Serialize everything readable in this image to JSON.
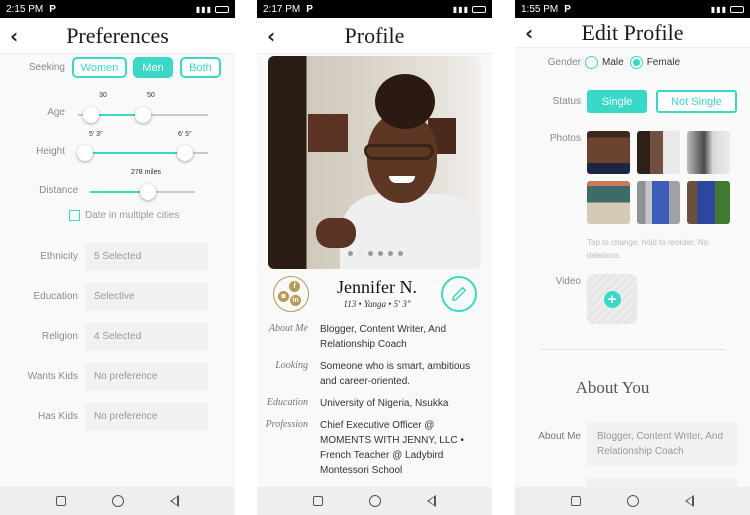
{
  "screens": {
    "preferences": {
      "status_time": "2:15 PM",
      "status_app": "P",
      "title": "Preferences",
      "seeking": {
        "label": "Seeking",
        "options": [
          "Women",
          "Men",
          "Both"
        ],
        "selected": "Men"
      },
      "age": {
        "label": "Age",
        "min_value": "30",
        "max_value": "50",
        "range_start": 0.1,
        "range_end": 0.5
      },
      "height": {
        "label": "Height",
        "min_value": "5' 3\"",
        "max_value": "6' 5\"",
        "range_start": 0.05,
        "range_end": 0.82
      },
      "distance": {
        "label": "Distance",
        "value": "278 miles",
        "fraction": 0.55
      },
      "multiple_cities": {
        "label": "Date in multiple cities",
        "checked": false
      },
      "fields": [
        {
          "label": "Ethnicity",
          "value": "5 Selected"
        },
        {
          "label": "Education",
          "value": "Selective"
        },
        {
          "label": "Religion",
          "value": "4 Selected"
        },
        {
          "label": "Wants Kids",
          "value": "No preference"
        },
        {
          "label": "Has Kids",
          "value": "No preference"
        }
      ]
    },
    "profile": {
      "status_time": "2:17 PM",
      "status_app": "P",
      "title": "Profile",
      "photo_count": 6,
      "active_photo": 2,
      "name": "Jennifer N.",
      "subtitle": "113 • Yanga • 5' 3\"",
      "social_icons": [
        "instagram",
        "facebook",
        "linkedin"
      ],
      "details": [
        {
          "label": "About Me",
          "value": "Blogger, Content Writer, And Relationship Coach"
        },
        {
          "label": "Looking",
          "value": "Someone who is smart, ambitious and career-oriented."
        },
        {
          "label": "Education",
          "value": "University of Nigeria, Nsukka"
        },
        {
          "label": "Profession",
          "value": "Chief Executive Officer @ MOMENTS WITH JENNY, LLC • French Teacher @ Ladybird Montessori School"
        }
      ]
    },
    "edit_profile": {
      "status_time": "1:55 PM",
      "status_app": "P",
      "title": "Edit Profile",
      "gender": {
        "label": "Gender",
        "options": [
          "Male",
          "Female"
        ],
        "selected": "Female"
      },
      "status": {
        "label": "Status",
        "options": [
          "Single",
          "Not Single"
        ],
        "selected": "Single"
      },
      "photos": {
        "label": "Photos",
        "count": 6,
        "hint": "Tap to change, hold to reorder. No deletions."
      },
      "video": {
        "label": "Video"
      },
      "about_heading": "About You",
      "about_me": {
        "label": "About Me",
        "value": "Blogger, Content Writer, And Relationship Coach"
      }
    }
  },
  "colors": {
    "accent": "#3ad8c7",
    "gold": "#b69a55"
  }
}
